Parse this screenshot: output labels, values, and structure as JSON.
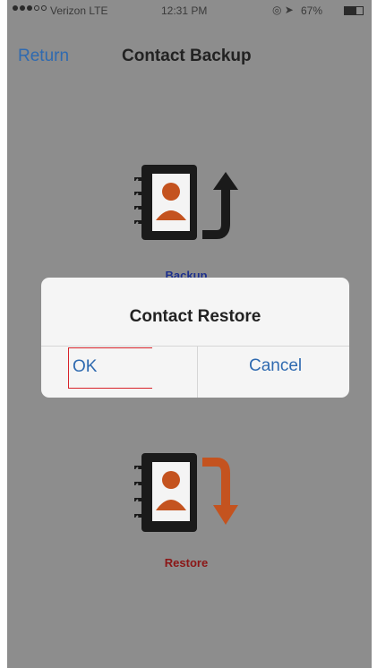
{
  "status_bar": {
    "carrier": "Verizon LTE",
    "time": "12:31 PM",
    "battery": "67%"
  },
  "nav": {
    "back_label": "Return",
    "title": "Contact Backup"
  },
  "backup": {
    "label": "Backup",
    "icon": "contact-book-arrow-up-icon"
  },
  "restore": {
    "label": "Restore",
    "icon": "contact-book-arrow-down-icon"
  },
  "dialog": {
    "title": "Contact Restore",
    "ok_label": "OK",
    "cancel_label": "Cancel"
  },
  "colors": {
    "link_blue": "#2f6ab0",
    "backup_blue": "#1c2f8c",
    "restore_red": "#8b1616",
    "accent_orange": "#c4531f",
    "overlay_gray": "#8d8d8d"
  }
}
